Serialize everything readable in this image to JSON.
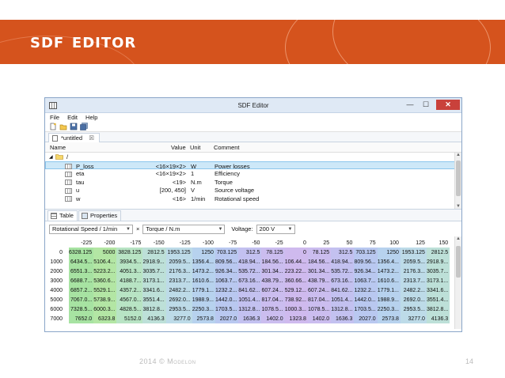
{
  "slide": {
    "title": "SDF Editor",
    "footer": "2014 © Modelon",
    "page_number": "14",
    "banner_color": "#d5531d"
  },
  "window": {
    "title": "SDF Editor",
    "buttons": {
      "minimize": "—",
      "maximize": "☐",
      "close": "✕"
    }
  },
  "menu": [
    "File",
    "Edit",
    "Help"
  ],
  "toolbar": [
    "new-file-icon",
    "open-folder-icon",
    "save-icon",
    "save-all-icon"
  ],
  "doc_tab": {
    "label": "*untitled",
    "close": "☒"
  },
  "tree": {
    "columns": {
      "name": "Name",
      "value": "Value",
      "unit": "Unit",
      "comment": "Comment"
    },
    "root": {
      "toggle": "◢",
      "label": "/"
    },
    "rows": [
      {
        "name": "P_loss",
        "value": "<16×19×2>",
        "unit": "W",
        "comment": "Power losses",
        "selected": true
      },
      {
        "name": "eta",
        "value": "<16×19×2>",
        "unit": "1",
        "comment": "Efficiency"
      },
      {
        "name": "tau",
        "value": "<19>",
        "unit": "N.m",
        "comment": "Torque"
      },
      {
        "name": "u",
        "value": "[200, 450]",
        "unit": "V",
        "comment": "Source voltage"
      },
      {
        "name": "w",
        "value": "<16>",
        "unit": "1/min",
        "comment": "Rotational speed"
      }
    ]
  },
  "bottom_tabs": [
    {
      "label": "Table",
      "active": true
    },
    {
      "label": "Properties",
      "active": false
    }
  ],
  "controls": {
    "row_axis": "Rotational Speed / 1/min",
    "times": "×",
    "col_axis": "Torque / N.m",
    "voltage_label": "Voltage:",
    "voltage_value": "200 V"
  },
  "grid": {
    "col_headers": [
      "-225",
      "-200",
      "-175",
      "-150",
      "-125",
      "-100",
      "-75",
      "-50",
      "-25",
      "0",
      "25",
      "50",
      "75",
      "100",
      "125",
      "150"
    ],
    "rows": [
      {
        "label": "0",
        "cells": [
          "6328.125",
          "5000",
          "3828.125",
          "2812.5",
          "1953.125",
          "1250",
          "703.125",
          "312.5",
          "78.125",
          "0",
          "78.125",
          "312.5",
          "703.125",
          "1250",
          "1953.125",
          "2812.5"
        ]
      },
      {
        "label": "1000",
        "cells": [
          "6434.5...",
          "5106.4...",
          "3934.5...",
          "2918.9...",
          "2059.5...",
          "1356.4...",
          "809.56...",
          "418.94...",
          "184.56...",
          "106.44...",
          "184.56...",
          "418.94...",
          "809.56...",
          "1356.4...",
          "2059.5...",
          "2918.9..."
        ]
      },
      {
        "label": "2000",
        "cells": [
          "6551.3...",
          "5223.2...",
          "4051.3...",
          "3035.7...",
          "2176.3...",
          "1473.2...",
          "926.34...",
          "535.72...",
          "301.34...",
          "223.22...",
          "301.34...",
          "535.72...",
          "926.34...",
          "1473.2...",
          "2176.3...",
          "3035.7..."
        ]
      },
      {
        "label": "3000",
        "cells": [
          "6688.7...",
          "5360.6...",
          "4188.7...",
          "3173.1...",
          "2313.7...",
          "1610.6...",
          "1063.7...",
          "673.16...",
          "438.79...",
          "360.66...",
          "438.79...",
          "673.16...",
          "1063.7...",
          "1610.6...",
          "2313.7...",
          "3173.1..."
        ]
      },
      {
        "label": "4000",
        "cells": [
          "6857.2...",
          "5529.1...",
          "4357.2...",
          "3341.6...",
          "2482.2...",
          "1779.1...",
          "1232.2...",
          "841.62...",
          "607.24...",
          "529.12...",
          "607.24...",
          "841.62...",
          "1232.2...",
          "1779.1...",
          "2482.2...",
          "3341.6..."
        ]
      },
      {
        "label": "5000",
        "cells": [
          "7067.0...",
          "5738.9...",
          "4567.0...",
          "3551.4...",
          "2692.0...",
          "1988.9...",
          "1442.0...",
          "1051.4...",
          "817.04...",
          "738.92...",
          "817.04...",
          "1051.4...",
          "1442.0...",
          "1988.9...",
          "2692.0...",
          "3551.4..."
        ]
      },
      {
        "label": "6000",
        "cells": [
          "7328.5...",
          "6000.3...",
          "4828.5...",
          "3812.8...",
          "2953.5...",
          "2250.3...",
          "1703.5...",
          "1312.8...",
          "1078.5...",
          "1000.3...",
          "1078.5...",
          "1312.8...",
          "1703.5...",
          "2250.3...",
          "2953.5...",
          "3812.8..."
        ]
      },
      {
        "label": "7000",
        "cells": [
          "7652.0",
          "6323.8",
          "5152.0",
          "4136.3",
          "3277.0",
          "2573.8",
          "2027.0",
          "1636.3",
          "1402.0",
          "1323.8",
          "1402.0",
          "1636.3",
          "2027.0",
          "2573.8",
          "3277.0",
          "4136.3"
        ]
      }
    ]
  }
}
